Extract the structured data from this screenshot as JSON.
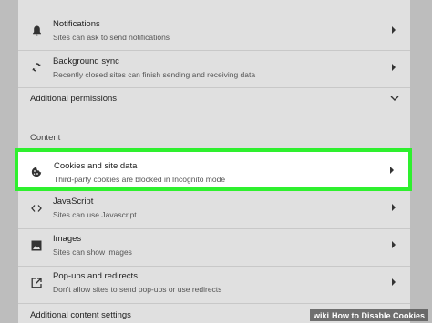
{
  "rows": {
    "notifications": {
      "title": "Notifications",
      "sub": "Sites can ask to send notifications"
    },
    "background_sync": {
      "title": "Background sync",
      "sub": "Recently closed sites can finish sending and receiving data"
    },
    "additional_permissions": {
      "label": "Additional permissions"
    },
    "content_header": {
      "label": "Content"
    },
    "cookies": {
      "title": "Cookies and site data",
      "sub": "Third-party cookies are blocked in Incognito mode"
    },
    "javascript": {
      "title": "JavaScript",
      "sub": "Sites can use Javascript"
    },
    "images": {
      "title": "Images",
      "sub": "Sites can show images"
    },
    "popups": {
      "title": "Pop-ups and redirects",
      "sub": "Don't allow sites to send pop-ups or use redirects"
    },
    "additional_content": {
      "label": "Additional content settings"
    }
  },
  "watermark": {
    "wiki": "wiki",
    "how": "How to Disable Cookies"
  },
  "colors": {
    "highlight": "#2ef02e"
  }
}
